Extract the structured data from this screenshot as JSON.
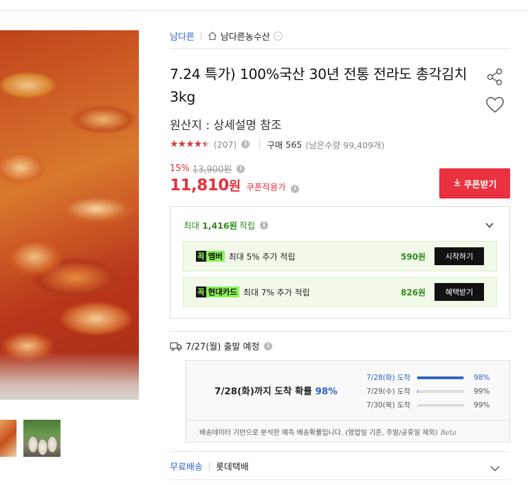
{
  "breadcrumb": {
    "brand": "남다른",
    "store": "남다른농수산"
  },
  "product": {
    "title": "7.24 특가) 100%국산 30년 전통 전라도 총각김치 3kg",
    "origin": "원산지 : 상세설명 참조",
    "rating": {
      "stars": 4.5,
      "review_count": "(207)"
    },
    "purchase": {
      "label": "구매",
      "count": "565",
      "stock": "(남은수량 99,409개)"
    }
  },
  "price": {
    "discount_rate": "15%",
    "original": "13,900원",
    "final": "11,810",
    "currency": "원",
    "coupon_note": "쿠폰적용가",
    "coupon_button": "쿠폰받기"
  },
  "points": {
    "head_prefix": "최대",
    "head_amount": "1,416원",
    "head_suffix": "적립",
    "benefits": [
      {
        "badge_k": "꼭",
        "badge_name": "멤버",
        "text": "최대 5% 추가 적립",
        "amount": "590원",
        "button": "시작하기"
      },
      {
        "badge_k": "꼭",
        "badge_name": "현대카드",
        "text": "최대 7% 추가 적립",
        "amount": "826원",
        "button": "혜택받기"
      }
    ]
  },
  "shipping": {
    "departure": "7/27(월) 출발 예정",
    "headline": "7/28(화)까지 도착 확률",
    "headline_pct": "98%",
    "distribution": [
      {
        "label": "7/28(화) 도착",
        "pct_text": "98%",
        "value": 98
      },
      {
        "label": "7/29(수) 도착",
        "pct_text": "99%",
        "value": 1
      },
      {
        "label": "7/30(목) 도착",
        "pct_text": "99%",
        "value": 0
      }
    ],
    "note": "배송데이터 기반으로 분석한 예측 배송확률입니다. (영업일 기준, 주말/공휴일 제외)",
    "beta": "Beta",
    "free_shipping": "무료배송",
    "carrier": "롯데택배"
  },
  "colors": {
    "accent_red": "#e2333f",
    "accent_blue": "#2d63c8",
    "point_green": "#2e8b1e",
    "badge_green": "#8df25a"
  },
  "icons": [
    "home-icon",
    "chevron-right-icon",
    "share-icon",
    "heart-icon",
    "info-icon",
    "download-icon",
    "chevron-down-icon",
    "truck-icon"
  ]
}
